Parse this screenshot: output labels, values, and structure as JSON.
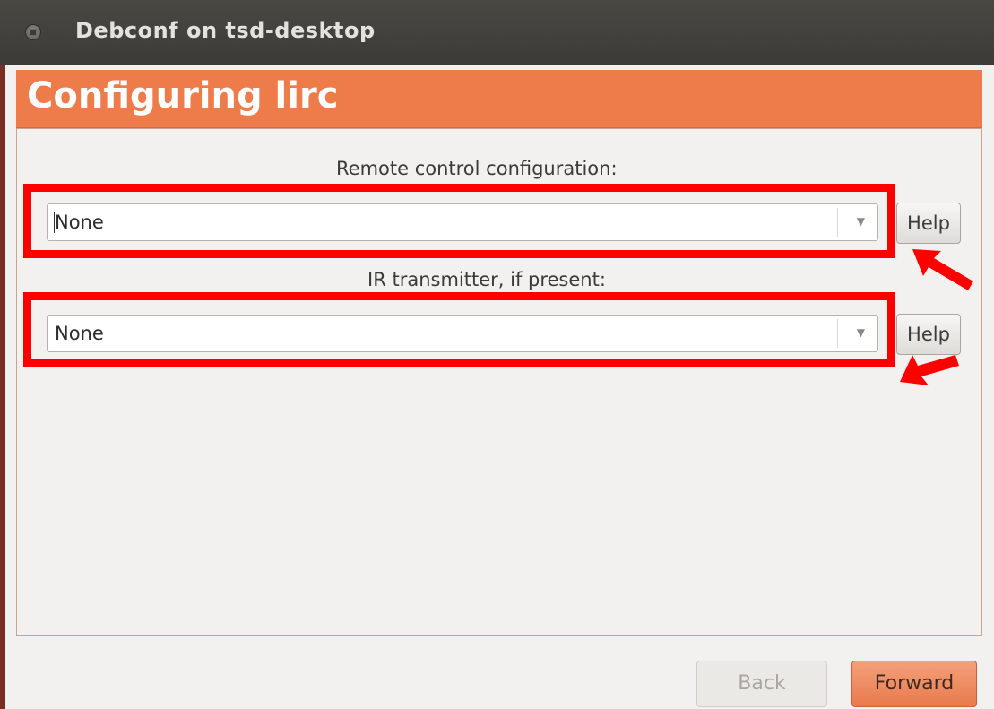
{
  "window": {
    "title": "Debconf on tsd-desktop"
  },
  "header": {
    "heading": "Configuring lirc",
    "color": "#ee7c4a"
  },
  "questions": [
    {
      "label": "Remote control configuration:",
      "selected": "None",
      "help_label": "Help"
    },
    {
      "label": "IR transmitter, if present:",
      "selected": "None",
      "help_label": "Help"
    }
  ],
  "footer": {
    "back_label": "Back",
    "forward_label": "Forward"
  },
  "annotations": {
    "highlight_color": "#ff0000"
  }
}
